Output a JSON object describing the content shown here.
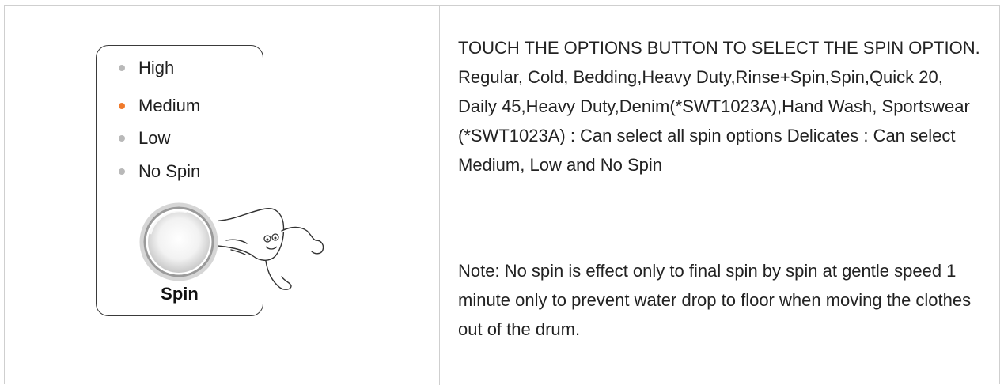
{
  "panel": {
    "options": [
      {
        "label": "High",
        "active": false
      },
      {
        "label": "Medium",
        "active": true
      },
      {
        "label": "Low",
        "active": false
      },
      {
        "label": "No Spin",
        "active": false
      }
    ],
    "button_label": "Spin",
    "colors": {
      "active_dot": "#f07a2b",
      "inactive_dot": "#b9b9b9"
    }
  },
  "description": {
    "paragraph1": "TOUCH THE OPTIONS BUTTON TO SELECT THE SPIN OPTION. Regular, Cold, Bedding,Heavy Duty,Rinse+Spin,Spin,Quick 20, Daily 45,Heavy Duty,Denim(*SWT1023A),Hand Wash, Sportswear (*SWT1023A) : Can select all spin options Delicates : Can select Medium, Low and No Spin",
    "paragraph2": "Note: No spin is effect only to final spin by spin at gentle speed 1 minute only to prevent water drop to floor when moving the clothes out of the drum."
  }
}
